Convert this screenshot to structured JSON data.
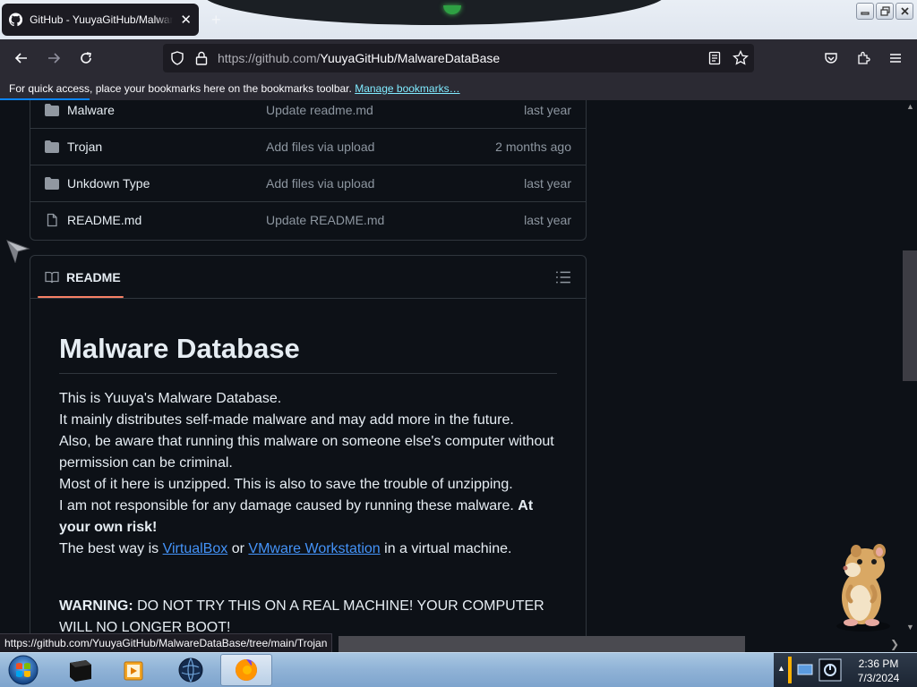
{
  "browser": {
    "tab_title": "GitHub - YuuyaGitHub/MalwareDataBase",
    "tab_close": "✕",
    "new_tab": "+",
    "url_host": "https://github.com/",
    "url_path": "YuuyaGitHub/MalwareDataBase",
    "bookmarks_text": "For quick access, place your bookmarks here on the bookmarks toolbar.",
    "bookmarks_link": "Manage bookmarks…",
    "status_url": "https://github.com/YuuyaGitHub/MalwareDataBase/tree/main/Trojan"
  },
  "files": [
    {
      "name": "Malware",
      "type": "folder",
      "message": "Update readme.md",
      "age": "last year"
    },
    {
      "name": "Trojan",
      "type": "folder",
      "message": "Add files via upload",
      "age": "2 months ago"
    },
    {
      "name": "Unkdown Type",
      "type": "folder",
      "message": "Add files via upload",
      "age": "last year"
    },
    {
      "name": "README.md",
      "type": "file",
      "message": "Update README.md",
      "age": "last year"
    }
  ],
  "readme": {
    "tab_label": "README",
    "title": "Malware Database",
    "line1": "This is Yuuya's Malware Database.",
    "line2": "It mainly distributes self-made malware and may add more in the future.",
    "line3": "Also, be aware that running this malware on someone else's computer without permission can be criminal.",
    "line4": "Most of it here is unzipped. This is also to save the trouble of unzipping.",
    "line5_text": "I am not responsible for any damage caused by running these malware.",
    "line5_bold": "At your own risk!",
    "line6_pre": "The best way is",
    "link1": "VirtualBox",
    "line6_mid": "or",
    "link2": "VMware Workstation",
    "line6_post": "in a virtual machine.",
    "warning_label": "WARNING:",
    "warning_text": "DO NOT TRY THIS ON A REAL MACHINE! YOUR COMPUTER WILL NO LONGER BOOT!"
  },
  "taskbar": {
    "time": "2:36 PM",
    "date": "7/3/2024"
  },
  "colors": {
    "page_bg": "#0d1117",
    "border": "#30363d",
    "link": "#4493f8",
    "tab_underline": "#f78166",
    "browser_chrome": "#2b2a33"
  }
}
